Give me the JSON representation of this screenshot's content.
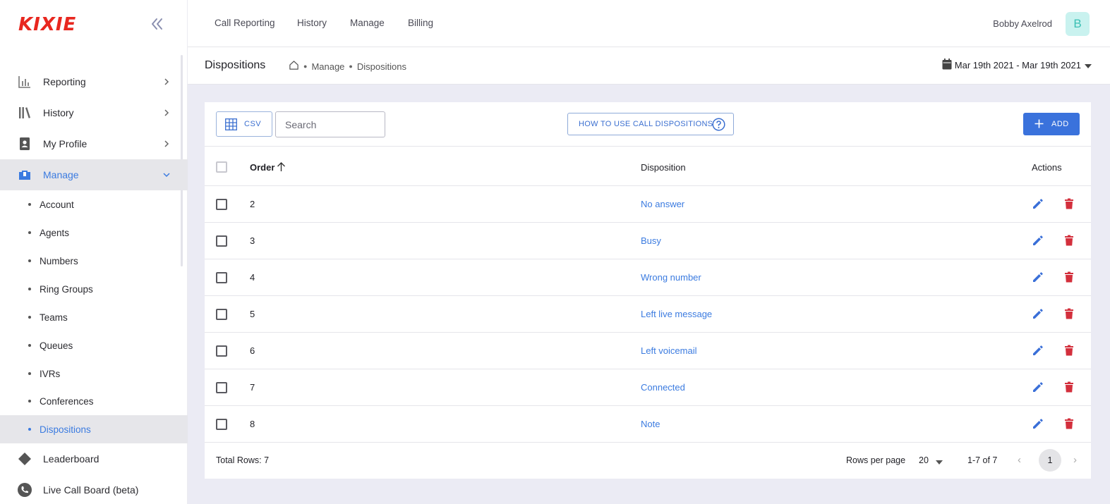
{
  "brand": {
    "logo": "KIXIE",
    "logo_color": "#e8271f",
    "accent": "#3b7be0",
    "danger": "#d32f3c"
  },
  "sidebar": {
    "items": [
      {
        "label": "Reporting",
        "icon": "bar-chart-icon"
      },
      {
        "label": "History",
        "icon": "library-icon"
      },
      {
        "label": "My Profile",
        "icon": "contact-card-icon"
      },
      {
        "label": "Manage",
        "icon": "toolbox-icon",
        "expanded": true
      }
    ],
    "manage_sub": [
      "Account",
      "Agents",
      "Numbers",
      "Ring Groups",
      "Teams",
      "Queues",
      "IVRs",
      "Conferences",
      "Dispositions"
    ],
    "active_sub": "Dispositions",
    "bottom_items": [
      {
        "label": "Leaderboard",
        "icon": "diamond-icon"
      },
      {
        "label": "Live Call Board (beta)",
        "icon": "phone-icon"
      }
    ]
  },
  "topnav": {
    "tabs": [
      "Call Reporting",
      "History",
      "Manage",
      "Billing"
    ],
    "user_name": "Bobby Axelrod",
    "avatar_initial": "B"
  },
  "header": {
    "title": "Dispositions",
    "breadcrumb": [
      "Manage",
      "Dispositions"
    ],
    "date_range": "Mar 19th 2021 - Mar 19th 2021"
  },
  "toolbar": {
    "csv_label": "CSV",
    "search_placeholder": "Search",
    "howto_label": "HOW TO USE CALL DISPOSITIONS",
    "add_label": "ADD"
  },
  "table": {
    "columns": {
      "order": "Order",
      "disposition": "Disposition",
      "actions": "Actions"
    },
    "sort": "ascending",
    "rows": [
      {
        "order": "2",
        "disposition": "No answer"
      },
      {
        "order": "3",
        "disposition": "Busy"
      },
      {
        "order": "4",
        "disposition": "Wrong number"
      },
      {
        "order": "5",
        "disposition": "Left live message"
      },
      {
        "order": "6",
        "disposition": "Left voicemail"
      },
      {
        "order": "7",
        "disposition": "Connected"
      },
      {
        "order": "8",
        "disposition": "Note"
      }
    ]
  },
  "footer": {
    "total_rows": "Total Rows: 7",
    "rows_per_page_label": "Rows per page",
    "rows_per_page_value": "20",
    "range": "1-7 of 7",
    "current_page": "1"
  }
}
